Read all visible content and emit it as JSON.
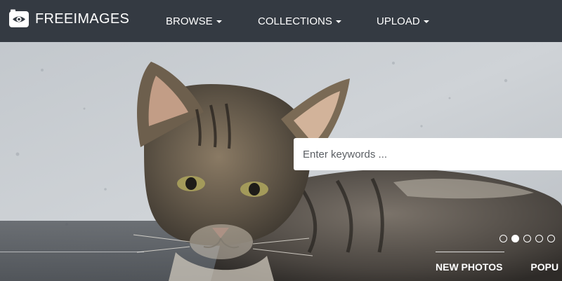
{
  "brand": {
    "name": "FREEIMAGES"
  },
  "nav": {
    "items": [
      {
        "label": "BROWSE"
      },
      {
        "label": "COLLECTIONS"
      },
      {
        "label": "UPLOAD"
      }
    ]
  },
  "search": {
    "placeholder": "Enter keywords ...",
    "value": ""
  },
  "carousel": {
    "slide_count": 5,
    "active_index": 1
  },
  "tabs": [
    {
      "label": "NEW PHOTOS"
    },
    {
      "label": "POPU"
    }
  ],
  "colors": {
    "nav_background": "#343a42",
    "nav_text": "#ffffff",
    "search_background": "#ffffff"
  },
  "icons": {
    "logo": "camera-eye-icon",
    "nav_caret": "caret-down-icon"
  }
}
